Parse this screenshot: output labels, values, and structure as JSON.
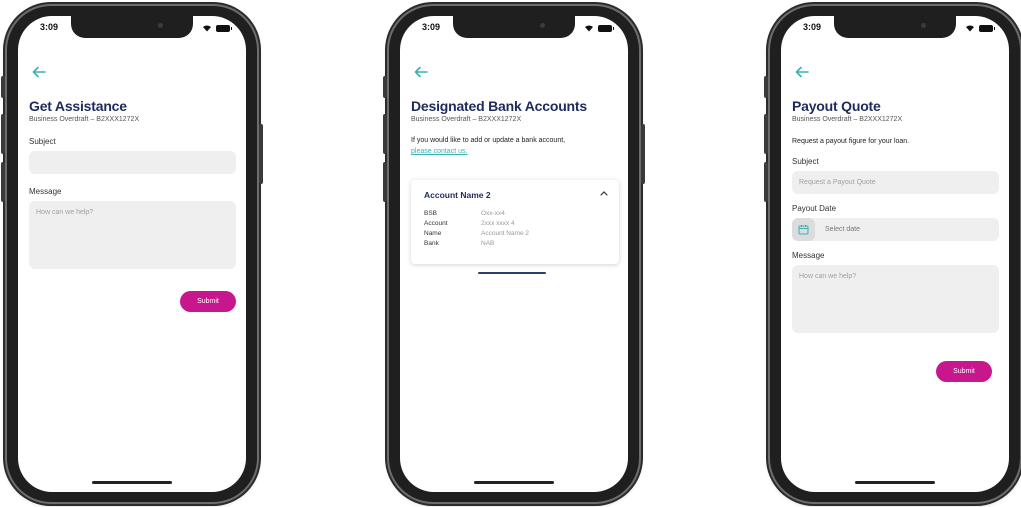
{
  "status": {
    "time": "3:09"
  },
  "screens": [
    {
      "title": "Get Assistance",
      "subtitle": "Business Overdraft – B2XXX1272X",
      "subject_label": "Subject",
      "subject_value": "",
      "message_label": "Message",
      "message_placeholder": "How can we help?",
      "submit_label": "Submit"
    },
    {
      "title": "Designated Bank Accounts",
      "subtitle": "Business Overdraft – B2XXX1272X",
      "info_text": "If you would like to add or update a bank account,",
      "info_link": "please contact us.",
      "account": {
        "name": "Account Name 2",
        "rows": [
          {
            "label": "BSB",
            "value": "Oxx-xx4"
          },
          {
            "label": "Account",
            "value": "2xxx xxxx 4"
          },
          {
            "label": "Name",
            "value": "Account Name 2"
          },
          {
            "label": "Bank",
            "value": "NAB"
          }
        ]
      }
    },
    {
      "title": "Payout Quote",
      "subtitle": "Business Overdraft – B2XXX1272X",
      "intro": "Request a payout figure for your loan.",
      "subject_label": "Subject",
      "subject_placeholder": "Request a Payout Quote",
      "date_label": "Payout Date",
      "date_placeholder": "Select date",
      "message_label": "Message",
      "message_placeholder": "How can we help?",
      "submit_label": "Submit"
    }
  ],
  "colors": {
    "accent": "#c8178d",
    "heading": "#1f2a5c",
    "link": "#3bb0b0",
    "back_arrow": "#3bb0b0"
  },
  "icons": [
    "back-arrow-icon",
    "wifi-icon",
    "battery-icon",
    "chevron-up-icon",
    "calendar-icon"
  ]
}
